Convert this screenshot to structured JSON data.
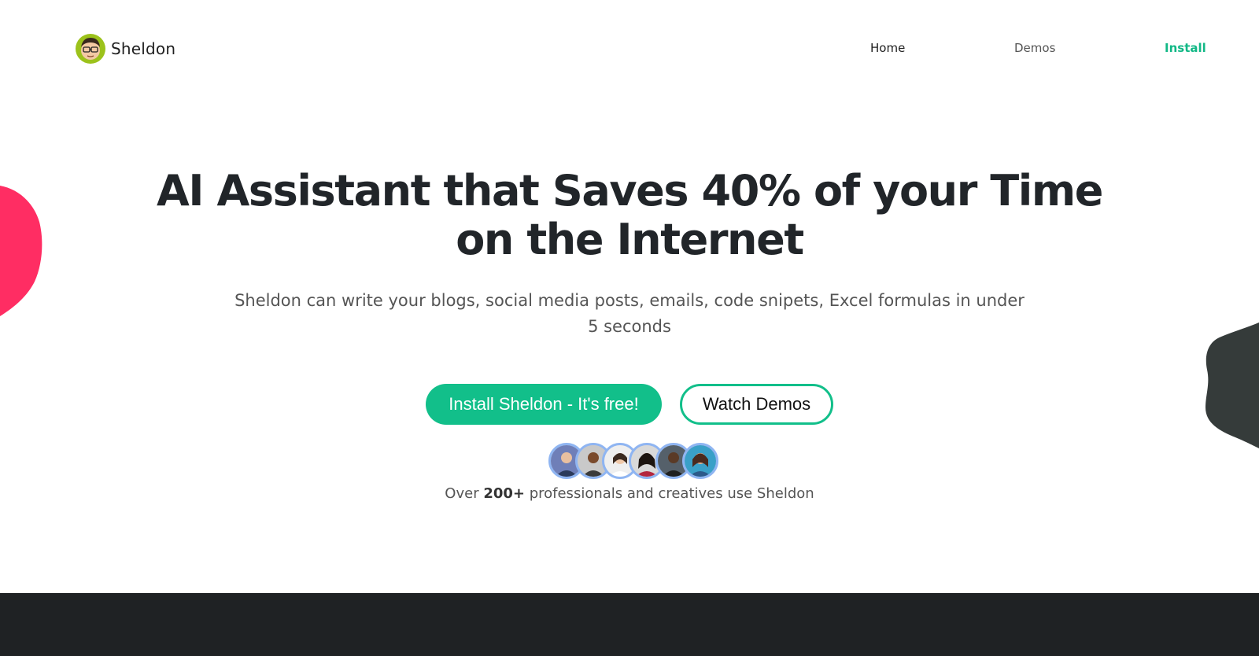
{
  "brand": {
    "name": "Sheldon",
    "logo_icon": "sheldon-avatar-icon"
  },
  "nav": {
    "items": [
      {
        "label": "Home",
        "color": "#1e1e1e"
      },
      {
        "label": "Demos",
        "color": "#555555"
      },
      {
        "label": "Install",
        "color": "#12b886"
      }
    ]
  },
  "hero": {
    "title_line1": "AI Assistant that Saves 40% of your Time",
    "title_line2": "on the Internet",
    "subtitle": "Sheldon can write your blogs, social media posts, emails, code snipets, Excel formulas in under 5 seconds",
    "primary_button": "Install Sheldon - It's free!",
    "secondary_button": "Watch Demos"
  },
  "social_proof": {
    "prefix": "Over ",
    "count": "200+",
    "suffix": " professionals and creatives use Sheldon",
    "avatar_count": 6
  },
  "colors": {
    "accent": "#12bf8a",
    "blob_left": "#ff2d63",
    "blob_right": "#353b3a",
    "footer": "#1f2224",
    "avatar_ring": "#8fb5f2"
  }
}
